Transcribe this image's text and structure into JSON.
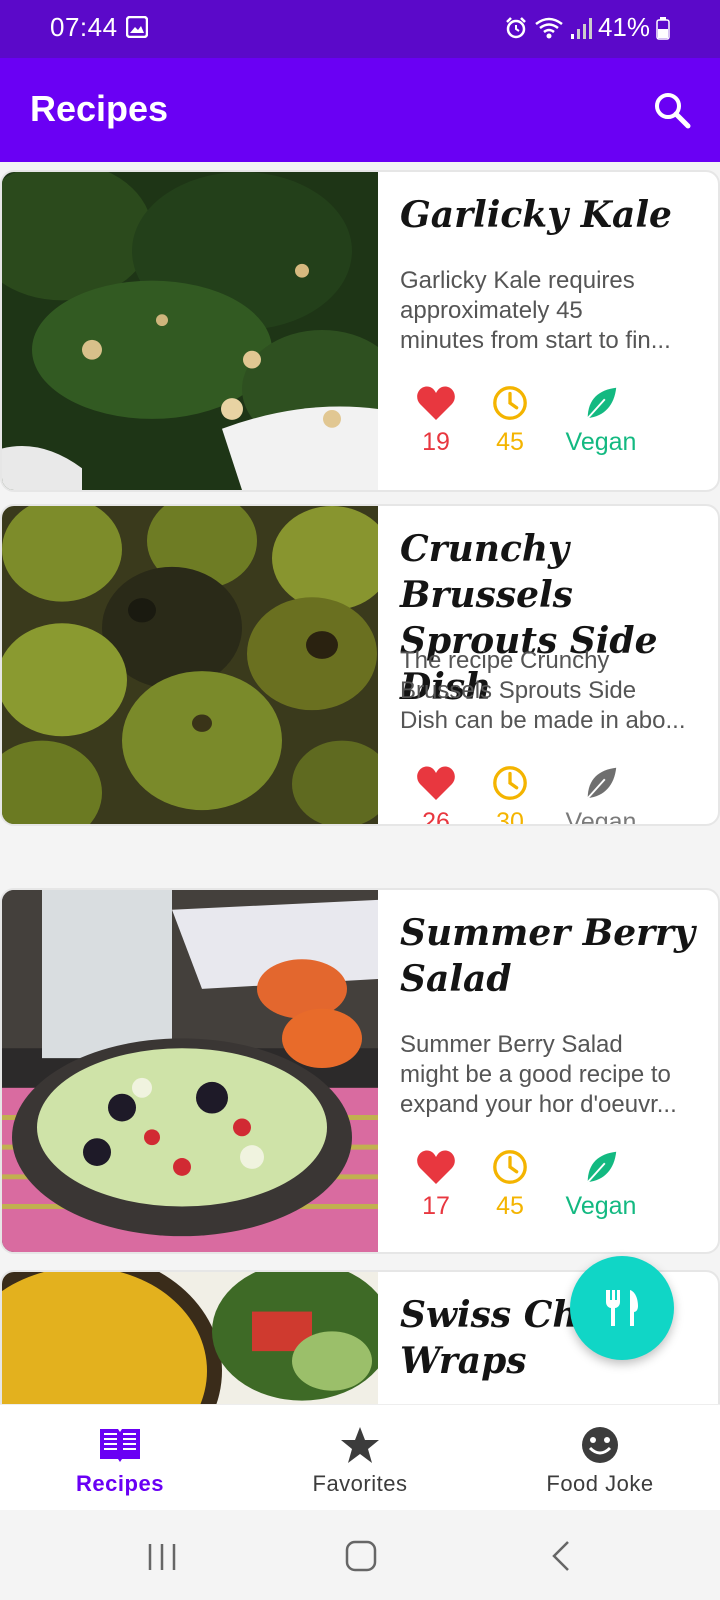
{
  "status_bar": {
    "time": "07:44",
    "battery": "41%"
  },
  "app_bar": {
    "title": "Recipes",
    "search_icon": "search-icon"
  },
  "recipes": [
    {
      "title_lines": [
        "Garlicky Kale"
      ],
      "description_lines": [
        "Garlicky Kale requires",
        "approximately 45",
        "minutes from start to fin..."
      ],
      "likes": "19",
      "minutes": "45",
      "vegan_label": "Vegan",
      "vegan": true
    },
    {
      "title_lines": [
        "Crunchy Brussels",
        "Sprouts Side Dish"
      ],
      "description_lines": [
        "The recipe Crunchy",
        "Brussels Sprouts Side",
        "Dish can be made in abo..."
      ],
      "likes": "26",
      "minutes": "30",
      "vegan_label": "Vegan",
      "vegan": false
    },
    {
      "title_lines": [
        "Summer Berry",
        "Salad"
      ],
      "description_lines": [
        "Summer Berry Salad",
        "might be a good recipe to",
        "expand your hor d'oeuvr..."
      ],
      "likes": "17",
      "minutes": "45",
      "vegan_label": "Vegan",
      "vegan": true
    },
    {
      "title_lines": [
        "Swiss Chard",
        "Wraps"
      ],
      "description_lines": [],
      "likes": "",
      "minutes": "",
      "vegan_label": "",
      "vegan": true
    }
  ],
  "fab": {
    "icon": "fork-knife-icon"
  },
  "bottom_nav": [
    {
      "label": "Recipes",
      "icon": "book-icon",
      "active": true
    },
    {
      "label": "Favorites",
      "icon": "star-icon",
      "active": false
    },
    {
      "label": "Food Joke",
      "icon": "smiley-icon",
      "active": false
    }
  ],
  "colors": {
    "status_bar": "#5b09c9",
    "app_bar": "#6a00f4",
    "like": "#e8373f",
    "time": "#f4b400",
    "vegan_on": "#13b981",
    "vegan_off": "#7a7a7a",
    "fab": "#10d6c6"
  }
}
